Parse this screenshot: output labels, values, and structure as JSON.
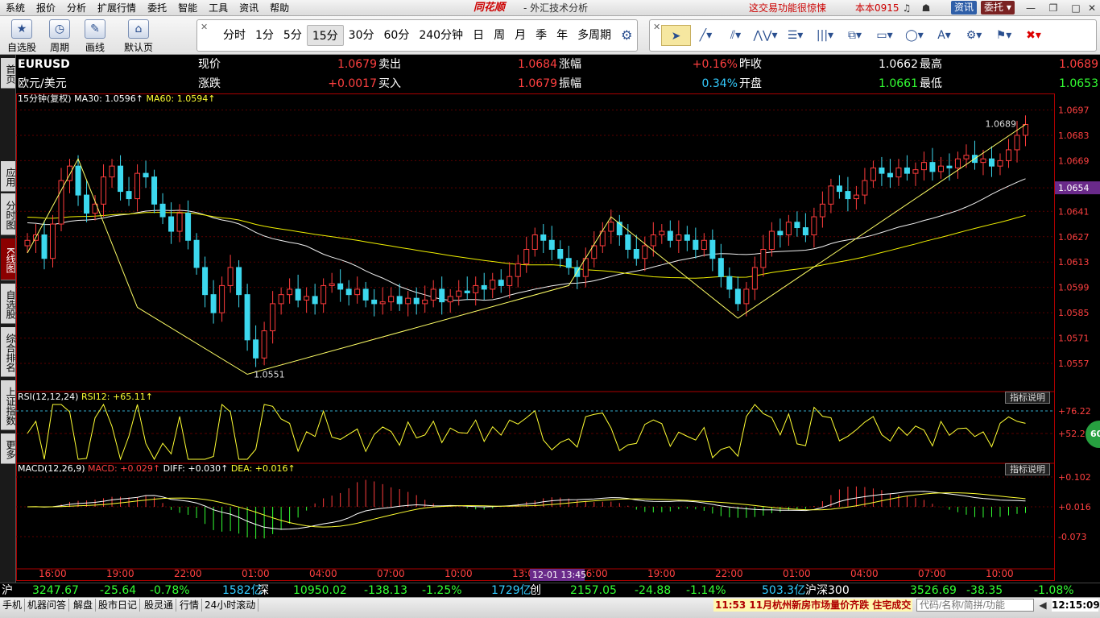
{
  "menu": [
    "系统",
    "报价",
    "分析",
    "扩展行情",
    "委托",
    "智能",
    "工具",
    "资讯",
    "帮助"
  ],
  "brand": {
    "logo": "同花顺",
    "subtitle": "- 外汇技术分析",
    "notice": "这交易功能很惊悚",
    "account": "本本0915",
    "news_btn": "资讯",
    "entrust_btn": "委托"
  },
  "toolbar": {
    "left": [
      {
        "label": "自选股",
        "icon": "star-icon"
      },
      {
        "label": "周期",
        "icon": "clock-icon"
      },
      {
        "label": "画线",
        "icon": "pencil-icon"
      },
      {
        "label": "默认页",
        "icon": "home-icon"
      }
    ],
    "periods": [
      "分时",
      "1分",
      "5分",
      "15分",
      "30分",
      "60分",
      "240分钟",
      "日",
      "周",
      "月",
      "季",
      "年",
      "多周期"
    ],
    "selected_period": "15分",
    "draw_tools": [
      "cursor-icon",
      "line-icon",
      "parallel-icon",
      "wave-icon",
      "fib-icon",
      "bars-icon",
      "channel-icon",
      "rect-icon",
      "ellipse-icon",
      "text-icon",
      "gear-icon",
      "mark-icon",
      "delete-icon"
    ]
  },
  "left_tabs": [
    "首页",
    "应用",
    "分时图",
    "K线图",
    "自选股",
    "综合排名",
    "上证指数",
    "更多"
  ],
  "quote": {
    "symbol": "EURUSD",
    "name": "欧元/美元",
    "now_label": "现价",
    "now": "1.0679",
    "chg_label": "涨跌",
    "chg": "+0.0017",
    "sell_label": "卖出",
    "sell": "1.0684",
    "buy_label": "买入",
    "buy": "1.0679",
    "pct_label": "涨幅",
    "pct": "+0.16%",
    "amp_label": "振幅",
    "amp": "0.34%",
    "prev_label": "昨收",
    "prev": "1.0662",
    "open_label": "开盘",
    "open": "1.0661",
    "high_label": "最高",
    "high": "1.0689",
    "low_label": "最低",
    "low": "1.0653"
  },
  "chart_labels": {
    "ma_title": "15分钟(复权)",
    "ma30": "MA30: 1.0596↑",
    "ma60": "MA60: 1.0594↑",
    "rsi": "RSI(12,12,24)",
    "rsi12": "RSI12: +65.11↑",
    "macd": "MACD(12,26,9)",
    "macd_val": "MACD: +0.029↑",
    "diff": "DIFF: +0.030↑",
    "dea": "DEA: +0.016↑",
    "ind_btn": "指标说明",
    "circle": "60",
    "high_mark": "1.0689",
    "low_mark": "1.0551",
    "cursor_price": "1.0654",
    "cursor_time": "12-01 13:45"
  },
  "chart_data": {
    "type": "candlestick",
    "price_ticks": [
      "1.0697",
      "1.0683",
      "1.0669",
      "1.0654",
      "1.0641",
      "1.0627",
      "1.0613",
      "1.0599",
      "1.0585",
      "1.0571",
      "1.0557"
    ],
    "price_range": [
      1.0545,
      1.0699
    ],
    "rsi_ticks": [
      "+76.22",
      "+52.29"
    ],
    "macd_ticks": [
      "+0.102",
      "+0.016",
      "-0.073"
    ],
    "time_ticks": [
      "16:00",
      "19:00",
      "22:00",
      "01:00",
      "04:00",
      "07:00",
      "10:00",
      "13:00",
      "16:00",
      "19:00",
      "22:00",
      "01:00",
      "04:00",
      "07:00",
      "10:00"
    ],
    "closes": [
      1.0625,
      1.0628,
      1.0615,
      1.0634,
      1.0658,
      1.0666,
      1.065,
      1.064,
      1.0645,
      1.066,
      1.0666,
      1.0652,
      1.0648,
      1.0662,
      1.066,
      1.0645,
      1.0638,
      1.063,
      1.064,
      1.0625,
      1.061,
      1.0595,
      1.0585,
      1.06,
      1.061,
      1.0595,
      1.057,
      1.056,
      1.0575,
      1.059,
      1.0595,
      1.0598,
      1.0592,
      1.0594,
      1.059,
      1.06,
      1.0601,
      1.0598,
      1.0595,
      1.0598,
      1.0592,
      1.059,
      1.0591,
      1.0594,
      1.059,
      1.0593,
      1.059,
      1.0592,
      1.0598,
      1.0591,
      1.0594,
      1.0597,
      1.0596,
      1.06,
      1.0598,
      1.0603,
      1.06,
      1.0605,
      1.0612,
      1.062,
      1.0628,
      1.0625,
      1.062,
      1.0615,
      1.061,
      1.0605,
      1.0615,
      1.0622,
      1.063,
      1.0635,
      1.0628,
      1.062,
      1.0615,
      1.0622,
      1.0628,
      1.063,
      1.0625,
      1.0628,
      1.0625,
      1.062,
      1.0625,
      1.0615,
      1.0605,
      1.0598,
      1.059,
      1.0598,
      1.061,
      1.062,
      1.063,
      1.0628,
      1.0635,
      1.0632,
      1.0628,
      1.0638,
      1.0645,
      1.0655,
      1.0652,
      1.0648,
      1.065,
      1.0658,
      1.0665,
      1.0662,
      1.066,
      1.0665,
      1.0662,
      1.0664,
      1.0668,
      1.0663,
      1.0666,
      1.0665,
      1.067,
      1.0672,
      1.0668,
      1.067,
      1.0666,
      1.0669,
      1.0675,
      1.0683,
      1.0689
    ],
    "ma30_start": 1.0635,
    "ma60_start": 1.0638
  },
  "ticker": {
    "sh_label": "沪",
    "sh_val": "3247.67",
    "sh_chg": "-25.64",
    "sh_pct": "-0.78%",
    "sh_amt": "1582亿",
    "sz_label": "深",
    "sz_val": "10950.02",
    "sz_chg": "-138.13",
    "sz_pct": "-1.25%",
    "sz_amt": "1729亿",
    "cy_label": "创",
    "cy_val": "2157.05",
    "cy_chg": "-24.88",
    "cy_pct": "-1.14%",
    "cy_amt": "503.3亿",
    "hs_label": "沪深300",
    "hs_val": "3526.69",
    "hs_chg": "-38.35",
    "hs_pct": "-1.08%"
  },
  "status": {
    "tabs": [
      "手机",
      "机器问答",
      "解盘",
      "股市日记",
      "股灵通",
      "行情",
      "24小时滚动"
    ],
    "news": "11:53 11月杭州新房市场量价齐跌 住宅成交",
    "search_placeholder": "代码/名称/简拼/功能",
    "clock": "12:15:09"
  }
}
